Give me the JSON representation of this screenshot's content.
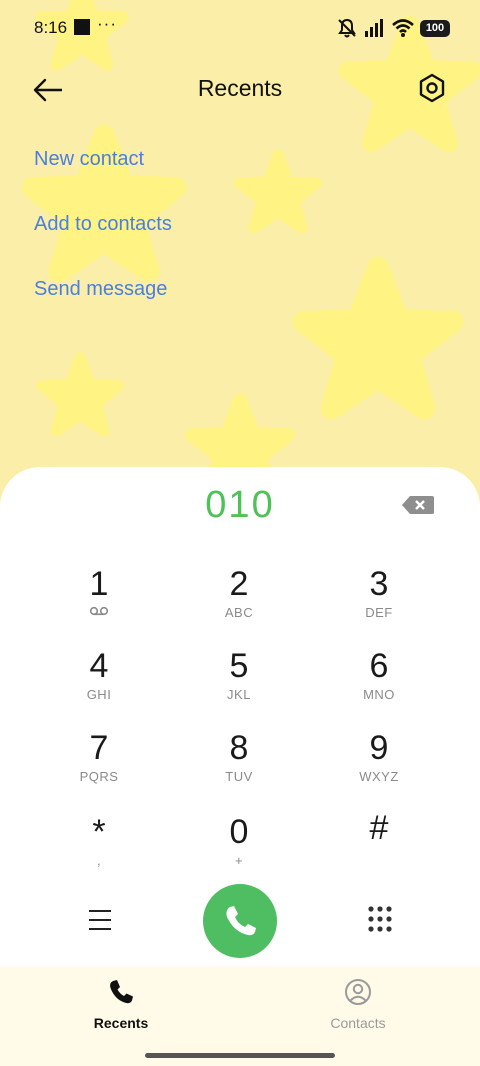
{
  "theme": {
    "background": "#fbeea8",
    "star": "#fff384",
    "link": "#4a7fe0",
    "accent_green": "#4fc156",
    "call_green": "#4fbe62"
  },
  "status_bar": {
    "time": "8:16",
    "dots": "···",
    "battery": "100",
    "icons": [
      "mute-bell-icon",
      "signal-icon",
      "wifi-icon",
      "battery-icon"
    ]
  },
  "header": {
    "title": "Recents",
    "back_icon": "back-arrow-icon",
    "settings_icon": "settings-hexagon-icon"
  },
  "actions": {
    "new_contact": "New contact",
    "add_to_contacts": "Add to contacts",
    "send_message": "Send message"
  },
  "dialer": {
    "number": "010",
    "keys": [
      {
        "digit": "1",
        "sub": "",
        "sub_icon": "voicemail-icon"
      },
      {
        "digit": "2",
        "sub": "ABC"
      },
      {
        "digit": "3",
        "sub": "DEF"
      },
      {
        "digit": "4",
        "sub": "GHI"
      },
      {
        "digit": "5",
        "sub": "JKL"
      },
      {
        "digit": "6",
        "sub": "MNO"
      },
      {
        "digit": "7",
        "sub": "PQRS"
      },
      {
        "digit": "8",
        "sub": "TUV"
      },
      {
        "digit": "9",
        "sub": "WXYZ"
      },
      {
        "digit": "*",
        "sub": ","
      },
      {
        "digit": "0",
        "sub": "+"
      },
      {
        "digit": "#",
        "sub": ""
      }
    ]
  },
  "bottom_nav": {
    "recents": "Recents",
    "contacts": "Contacts"
  }
}
